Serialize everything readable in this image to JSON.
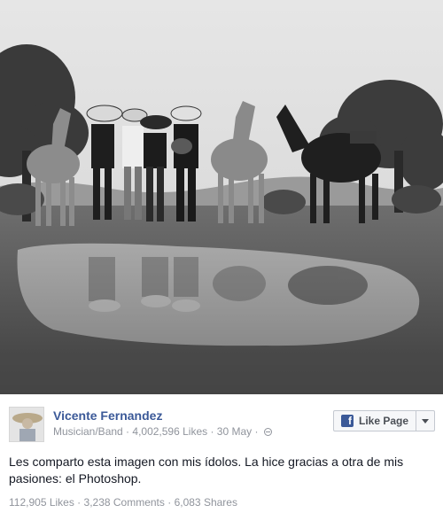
{
  "post": {
    "page_name": "Vicente Fernandez",
    "category": "Musician/Band",
    "page_likes": "4,002,596 Likes",
    "date": "30 May",
    "text": "Les comparto esta imagen con mis ídolos. La hice gracias a otra de mis pasiones: el Photoshop.",
    "stats": {
      "likes": "112,905 Likes",
      "comments": "3,238 Comments",
      "shares": "6,083 Shares"
    }
  },
  "like_button": {
    "label": "Like Page",
    "icon": "facebook-f-icon",
    "dropdown_icon": "caret-down-icon"
  },
  "meta_separator": " · ",
  "colors": {
    "link_blue": "#3b5998",
    "meta_gray": "#90949c",
    "text": "#141823",
    "button_bg": "#f6f7f9"
  }
}
